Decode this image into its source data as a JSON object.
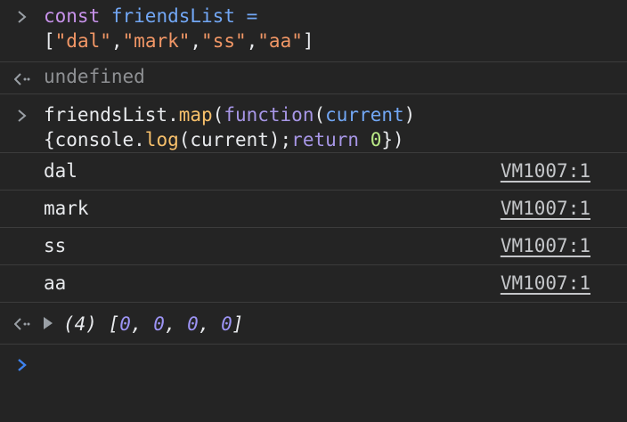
{
  "input1": {
    "line1": {
      "kw": "const",
      "var": "friendsList",
      "op": " ="
    },
    "line2": {
      "open": "[",
      "s1": "\"dal\"",
      "s2": "\"mark\"",
      "s3": "\"ss\"",
      "s4": "\"aa\"",
      "comma": ",",
      "close": "]"
    }
  },
  "result1": {
    "value": "undefined"
  },
  "input2": {
    "line1": {
      "obj": "friendsList",
      "dot": ".",
      "method": "map",
      "p1": "(",
      "fn": "function",
      "p2": "(",
      "param": "current",
      "p3": ")"
    },
    "line2": {
      "b1": "{console.",
      "log": "log",
      "p": "(current);",
      "ret": "return",
      "sp": " ",
      "zero": "0",
      "end": "})"
    }
  },
  "logs": [
    {
      "text": "dal",
      "source": "VM1007:1"
    },
    {
      "text": "mark",
      "source": "VM1007:1"
    },
    {
      "text": "ss",
      "source": "VM1007:1"
    },
    {
      "text": "aa",
      "source": "VM1007:1"
    }
  ],
  "result2": {
    "count": "(4)",
    "open": "[",
    "v1": "0",
    "v2": "0",
    "v3": "0",
    "v4": "0",
    "sep": ", ",
    "close": "]"
  },
  "colors": {
    "background": "#242424",
    "prompt": "#3e83f0",
    "string": "#f29766",
    "keyword": "#c792ea",
    "variable": "#72a7f5",
    "number": "#b9e986"
  }
}
